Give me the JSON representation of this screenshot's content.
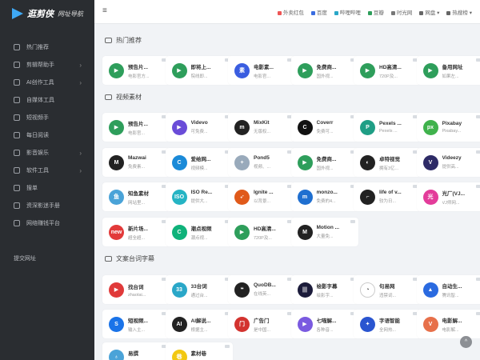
{
  "brand": {
    "name": "逛剪侠",
    "sub": "网址导航"
  },
  "sidebar": {
    "items": [
      {
        "label": "热门推荐",
        "arrow": ""
      },
      {
        "label": "剪辑帮助手",
        "arrow": "›"
      },
      {
        "label": "AI创作工具",
        "arrow": "›"
      },
      {
        "label": "自媒体工具",
        "arrow": ""
      },
      {
        "label": "短视频手",
        "arrow": ""
      },
      {
        "label": "每日阅读",
        "arrow": ""
      },
      {
        "label": "影音娱乐",
        "arrow": "›"
      },
      {
        "label": "软件工具",
        "arrow": "›"
      },
      {
        "label": "搜单",
        "arrow": ""
      },
      {
        "label": "资深影迷手册",
        "arrow": ""
      },
      {
        "label": "网络赚钱平台",
        "arrow": ""
      }
    ],
    "submit": "提交网址"
  },
  "topbar": {
    "menu_icon": "≡",
    "links": [
      "外卖红包",
      "百度",
      "哔哩哔哩",
      "豆瓣",
      "时光网",
      "网盘 ▾",
      "热搜榜 ▾"
    ]
  },
  "sections": [
    {
      "title": "热门推荐"
    },
    {
      "title": "视频素材"
    },
    {
      "title": "文案台词字幕"
    }
  ],
  "cards": [
    {
      "name": "预告片...",
      "desc": "电影官方...",
      "color": "#2e9e5b",
      "glyph": "▶"
    },
    {
      "name": "即将上...",
      "desc": "院线即...",
      "color": "#2e9e5b",
      "glyph": "▶"
    },
    {
      "name": "电影素...",
      "desc": "电影官...",
      "color": "#3a5de0",
      "glyph": "素"
    },
    {
      "name": "免费商...",
      "desc": "国外视...",
      "color": "#2e9e5b",
      "glyph": "▶"
    },
    {
      "name": "HD高清...",
      "desc": "720P及...",
      "color": "#2e9e5b",
      "glyph": "▶"
    },
    {
      "name": "备用网址",
      "desc": "如果左...",
      "color": "#2e9e5b",
      "glyph": "▶"
    },
    {
      "name": "预告片...",
      "desc": "电影官...",
      "color": "#2e9e5b",
      "glyph": "▶"
    },
    {
      "name": "Videvo",
      "desc": "可免费...",
      "color": "#6a4cd8",
      "glyph": "▶"
    },
    {
      "name": "MixKit",
      "desc": "无版权...",
      "color": "#222",
      "glyph": "m"
    },
    {
      "name": "Coverr",
      "desc": "免费可...",
      "color": "#111",
      "glyph": "C"
    },
    {
      "name": "Pexels ...",
      "desc": "Pexels ...",
      "color": "#1f9e85",
      "glyph": "P"
    },
    {
      "name": "Pixabay",
      "desc": "Pixabay...",
      "color": "#3fb24c",
      "glyph": "px"
    },
    {
      "name": "Mazwai",
      "desc": "免费素...",
      "color": "#222",
      "glyph": "M"
    },
    {
      "name": "爱给网...",
      "desc": "视频模...",
      "color": "#1a8ad8",
      "glyph": "C"
    },
    {
      "name": "Pond5",
      "desc": "视频、...",
      "color": "#9ab",
      "glyph": "+"
    },
    {
      "name": "免费商...",
      "desc": "国外视...",
      "color": "#2e9e5b",
      "glyph": "▶"
    },
    {
      "name": "卓特视觉",
      "desc": "拥有3亿...",
      "color": "#222",
      "glyph": "◐"
    },
    {
      "name": "Videezy",
      "desc": "提供高...",
      "color": "#2d2a66",
      "glyph": "V"
    },
    {
      "name": "知鱼素材",
      "desc": "网站里...",
      "color": "#4aa3d8",
      "glyph": "鱼"
    },
    {
      "name": "ISO Re...",
      "desc": "提供大...",
      "color": "#25b4c4",
      "glyph": "ISO"
    },
    {
      "name": "Ignite ...",
      "desc": "以背景...",
      "color": "#e05a1a",
      "glyph": "➶"
    },
    {
      "name": "monzo...",
      "desc": "免费的4...",
      "color": "#1f6fd0",
      "glyph": "m"
    },
    {
      "name": "life of v...",
      "desc": "较为日...",
      "color": "#222",
      "glyph": "⌐"
    },
    {
      "name": "光厂(VJ...",
      "desc": "VJ师网...",
      "color": "#e33c9a",
      "glyph": "光"
    },
    {
      "name": "新片场...",
      "desc": "超全超...",
      "color": "#e23a3a",
      "glyph": "new"
    },
    {
      "name": "潮点视频",
      "desc": "潮点视...",
      "color": "#0fb27a",
      "glyph": "C"
    },
    {
      "name": "HD高清...",
      "desc": "720P及...",
      "color": "#2e9e5b",
      "glyph": "▶"
    },
    {
      "name": "Motion ...",
      "desc": "大量免...",
      "color": "#222",
      "glyph": "M"
    },
    {
      "name": "找台词",
      "desc": "zhaotai...",
      "color": "#e03a3a",
      "glyph": "▶"
    },
    {
      "name": "33台词",
      "desc": "通过台...",
      "color": "#2aa7c8",
      "glyph": "33"
    },
    {
      "name": "QuoDB...",
      "desc": "在线英...",
      "color": "#222",
      "glyph": "❝"
    },
    {
      "name": "绘影字幕",
      "desc": "绘影字...",
      "color": "#1b1b3a",
      "glyph": "|||"
    },
    {
      "name": "句易网",
      "desc": "违禁词...",
      "color": "#fff",
      "glyph": "◔"
    },
    {
      "name": "自动生...",
      "desc": "腾讯智...",
      "color": "#2a6ae0",
      "glyph": "▲"
    },
    {
      "name": "短视频...",
      "desc": "输入主...",
      "color": "#1a73e8",
      "glyph": "S"
    },
    {
      "name": "AI解说...",
      "desc": "根据主...",
      "color": "#222",
      "glyph": "AI"
    },
    {
      "name": "广告门",
      "desc": "是中国...",
      "color": "#d3332f",
      "glyph": "门"
    },
    {
      "name": "七喵解...",
      "desc": "各种音...",
      "color": "#7a5ae0",
      "glyph": "▶"
    },
    {
      "name": "字语智能",
      "desc": "全网热...",
      "color": "#2a55d0",
      "glyph": "✦"
    },
    {
      "name": "电影解...",
      "desc": "电影解...",
      "color": "#e7704a",
      "glyph": "V"
    },
    {
      "name": "易撰",
      "desc": "让内容...",
      "color": "#4aa3d8",
      "glyph": "♁"
    },
    {
      "name": "素材巷",
      "desc": "素材巷...",
      "color": "#f2c811",
      "glyph": "巷"
    }
  ],
  "back_top": "^"
}
